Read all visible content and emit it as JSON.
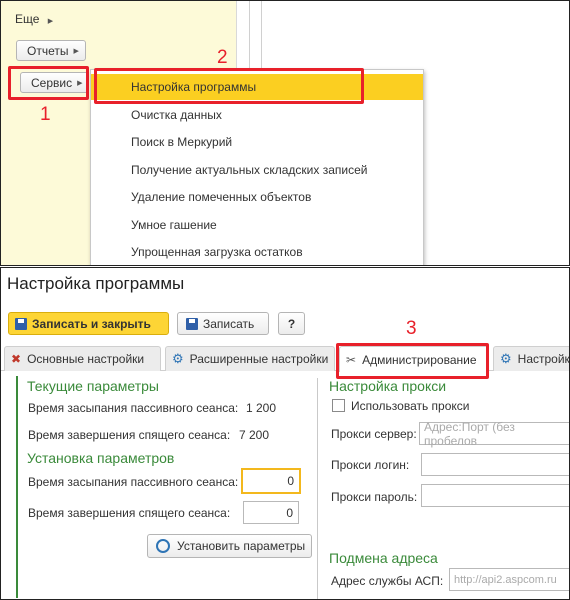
{
  "top": {
    "more_label": "Еще",
    "reports_button": "Отчеты",
    "service_button": "Сервис",
    "menu_items": [
      "Настройка программы",
      "Очистка данных",
      "Поиск в Меркурий",
      "Получение актуальных складских записей",
      "Удаление помеченных объектов",
      "Умное гашение",
      "Упрощенная загрузка остатков"
    ],
    "annotations": [
      "1",
      "2",
      "3"
    ]
  },
  "form": {
    "title": "Настройка программы",
    "toolbar": {
      "save_close": "Записать и закрыть",
      "save": "Записать",
      "help": "?"
    },
    "tabs": [
      "Основные настройки",
      "Расширенные настройки",
      "Администрирование",
      "Настройки"
    ],
    "current_params": {
      "heading": "Текущие параметры",
      "passive_label": "Время засыпания пассивного сеанса:",
      "passive_value": "1 200",
      "sleeping_label": "Время завершения спящего сеанса:",
      "sleeping_value": "7 200"
    },
    "set_params": {
      "heading": "Установка параметров",
      "passive_label": "Время засыпания пассивного сеанса:",
      "passive_value": "0",
      "sleeping_label": "Время завершения спящего сеанса:",
      "sleeping_value": "0",
      "apply_button": "Установить параметры"
    },
    "proxy": {
      "heading": "Настройка прокси",
      "use_proxy_label": "Использовать прокси",
      "use_proxy_checked": false,
      "server_label": "Прокси сервер:",
      "server_placeholder": "Адрес:Порт (без пробелов",
      "login_label": "Прокси логин:",
      "password_label": "Прокси пароль:"
    },
    "address": {
      "heading": "Подмена адреса",
      "asp_label": "Адрес службы АСП:",
      "asp_placeholder": "http://api2.aspcom.ru"
    }
  },
  "colors": {
    "highlight_red": "#e8202a",
    "menu_selected": "#fbcf21",
    "primary_button": "#fdd535",
    "section_green": "#3a8a3a",
    "side_panel": "#fdfad8"
  }
}
